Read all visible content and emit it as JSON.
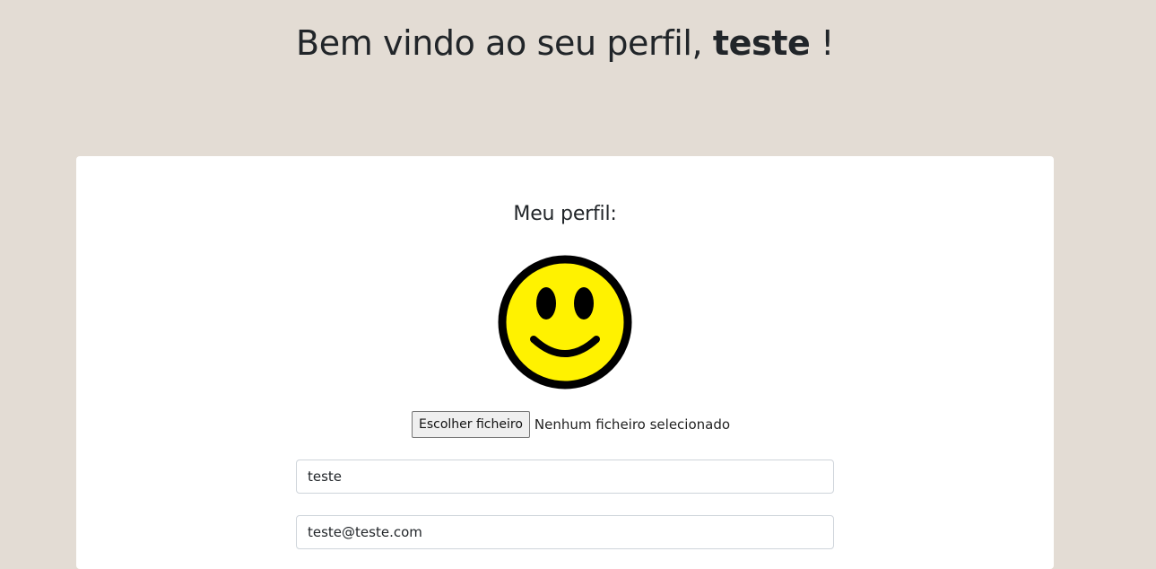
{
  "header": {
    "welcome_prefix": "Bem vindo ao seu perfil,",
    "username": "teste",
    "welcome_suffix": "!"
  },
  "profile": {
    "section_title": "Meu perfil:",
    "avatar_icon": "smiley-face-icon",
    "file_upload": {
      "button_label": "Escolher ficheiro",
      "status": "Nenhum ficheiro selecionado"
    },
    "name_field": {
      "value": "teste"
    },
    "email_field": {
      "value": "teste@teste.com"
    }
  },
  "colors": {
    "page_background": "#e3dcd4",
    "card_background": "#ffffff",
    "avatar_fill": "#fff200",
    "avatar_outline": "#000000"
  }
}
